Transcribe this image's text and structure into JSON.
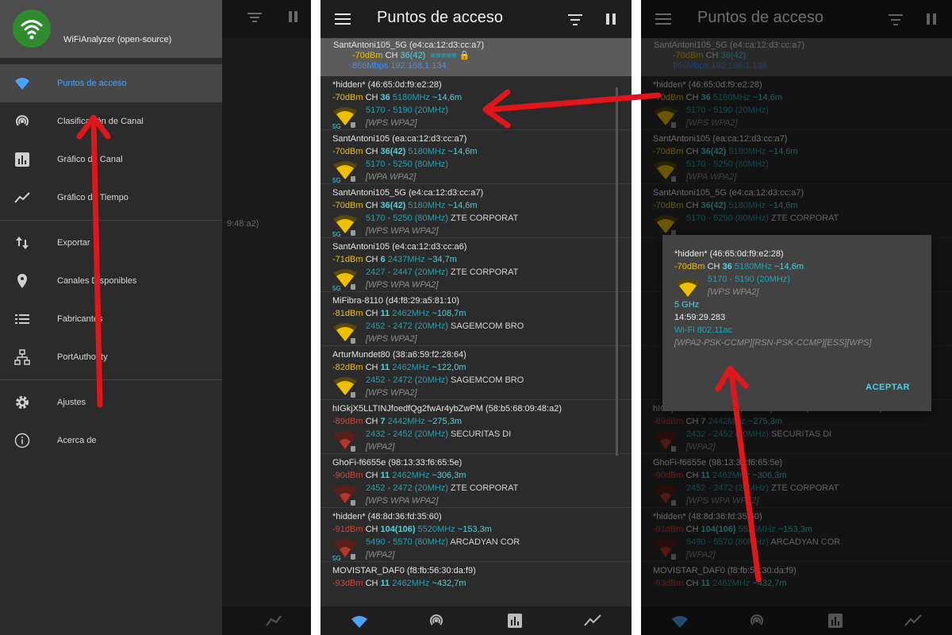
{
  "app": {
    "title": "Puntos de acceso",
    "drawer_app_name": "WiFiAnalyzer (open-source)"
  },
  "colors": {
    "accent": "#4fd3e0",
    "signal_good": "#f0c000",
    "signal_bad": "#d9412f",
    "arrow": "#e0161b",
    "drawer_active": "#4aa3ff"
  },
  "drawer": {
    "items": [
      {
        "label": "Puntos de acceso",
        "icon": "wifi-icon"
      },
      {
        "label": "Clasificación de Canal",
        "icon": "antenna-icon"
      },
      {
        "label": "Gráfico de Canal",
        "icon": "bar-chart-icon"
      },
      {
        "label": "Gráfico de Tiempo",
        "icon": "line-chart-icon"
      },
      {
        "label": "Exportar",
        "icon": "swap-vert-icon"
      },
      {
        "label": "Canales Disponibles",
        "icon": "location-pin-icon"
      },
      {
        "label": "Fabricantes",
        "icon": "list-icon"
      },
      {
        "label": "PortAuthority",
        "icon": "network-icon"
      },
      {
        "label": "Ajustes",
        "icon": "settings-icon"
      },
      {
        "label": "Acerca de",
        "icon": "info-icon"
      }
    ],
    "background_mac_fragment": "9:48:a2)"
  },
  "connected": {
    "ssid": "SantAntoni105_5G (e4:ca:12:d3:cc:a7)",
    "level": "-70dBm",
    "ch_label": "CH",
    "channel": "36(42)",
    "speed_ip": "866Mbps 192.168.1.134"
  },
  "access_points": [
    {
      "ssid": "*hidden* (46:65:0d:f9:e2:28)",
      "level": "-70dBm",
      "red": false,
      "channel": "36",
      "freq": "5180MHz",
      "dist": "~14,6m",
      "range": "5170 - 5190 (20MHz)",
      "vendor": "",
      "cap": "[WPS WPA2]",
      "band": "5G"
    },
    {
      "ssid": "SantAntoni105 (ea:ca:12:d3:cc:a7)",
      "level": "-70dBm",
      "red": false,
      "channel": "36(42)",
      "freq": "5180MHz",
      "dist": "~14,6m",
      "range": "5170 - 5250 (80MHz)",
      "vendor": "",
      "cap": "[WPA WPA2]",
      "band": "5G"
    },
    {
      "ssid": "SantAntoni105_5G (e4:ca:12:d3:cc:a7)",
      "level": "-70dBm",
      "red": false,
      "channel": "36(42)",
      "freq": "5180MHz",
      "dist": "~14,6m",
      "range": "5170 - 5250 (80MHz)",
      "vendor": "ZTE CORPORAT",
      "cap": "[WPS WPA WPA2]",
      "band": "5G"
    },
    {
      "ssid": "SantAntoni105 (e4:ca:12:d3:cc:a6)",
      "level": "-71dBm",
      "red": false,
      "channel": "6",
      "freq": "2437MHz",
      "dist": "~34,7m",
      "range": "2427 - 2447 (20MHz)",
      "vendor": "ZTE CORPORAT",
      "cap": "[WPS WPA WPA2]",
      "band": "5G"
    },
    {
      "ssid": "MiFibra-8110 (d4:f8:29:a5:81:10)",
      "level": "-81dBm",
      "red": false,
      "channel": "11",
      "freq": "2462MHz",
      "dist": "~108,7m",
      "range": "2452 - 2472 (20MHz)",
      "vendor": "SAGEMCOM BRO",
      "cap": "[WPS WPA2]",
      "band": ""
    },
    {
      "ssid": "ArturMundet80 (38:a6:59:f2:28:64)",
      "level": "-82dBm",
      "red": false,
      "channel": "11",
      "freq": "2462MHz",
      "dist": "~122,0m",
      "range": "2452 - 2472 (20MHz)",
      "vendor": "SAGEMCOM BRO",
      "cap": "[WPS WPA2]",
      "band": ""
    },
    {
      "ssid": "hIGkjX5LLTINJfoedfQg2fwAr4ybZwPM (58:b5:68:09:48:a2)",
      "level": "-89dBm",
      "red": true,
      "channel": "7",
      "freq": "2442MHz",
      "dist": "~275,3m",
      "range": "2432 - 2452 (20MHz)",
      "vendor": "SECURITAS DI",
      "cap": "[WPA2]",
      "band": ""
    },
    {
      "ssid": "GhoFi-f6655e (98:13:33:f6:65:5e)",
      "level": "-90dBm",
      "red": true,
      "channel": "11",
      "freq": "2462MHz",
      "dist": "~306,3m",
      "range": "2452 - 2472 (20MHz)",
      "vendor": "ZTE CORPORAT",
      "cap": "[WPS WPA WPA2]",
      "band": ""
    },
    {
      "ssid": "*hidden* (48:8d:36:fd:35:60)",
      "level": "-91dBm",
      "red": true,
      "channel": "104(106)",
      "freq": "5520MHz",
      "dist": "~153,3m",
      "range": "5490 - 5570 (80MHz)",
      "vendor": "ARCADYAN COR",
      "cap": "[WPA2]",
      "band": "5G"
    },
    {
      "ssid": "MOVISTAR_DAF0 (f8:fb:56:30:da:f9)",
      "level": "-93dBm",
      "red": true,
      "channel": "11",
      "freq": "2462MHz",
      "dist": "~432,7m",
      "range": "",
      "vendor": "",
      "cap": "",
      "band": ""
    }
  ],
  "screen3_list": [
    {
      "ssid": "*hidden* (46:65:0d:f9:e2:28)",
      "level": "-70dBm",
      "red": false,
      "channel": "36",
      "freq": "5180MHz",
      "dist": "~14,6m",
      "range": "5170 - 5190 (20MHz)",
      "vendor": "",
      "cap": "[WPS WPA2]",
      "band": ""
    },
    {
      "ssid": "SantAntoni105 (ea:ca:12:d3:cc:a7)",
      "level": "-70dBm",
      "red": false,
      "channel": "36(42)",
      "freq": "5180MHz",
      "dist": "~14,6m",
      "range": "5170 - 5250 (80MHz)",
      "vendor": "",
      "cap": "[WPA WPA2]",
      "band": ""
    },
    {
      "ssid": "SantAntoni105_5G (e4:ca:12:d3:cc:a7)",
      "level": "-70dBm",
      "red": false,
      "channel": "36(42)",
      "freq": "5180MHz",
      "dist": "~14,6m",
      "range": "5170 - 5250 (80MHz)",
      "vendor": "ZTE CORPORAT",
      "cap": "",
      "band": ""
    },
    {
      "ssid": "",
      "level": "",
      "red": false,
      "channel": "",
      "freq": "",
      "dist": "",
      "range": "",
      "vendor": "",
      "cap": "",
      "band": ""
    },
    {
      "ssid": "",
      "level": "",
      "red": false,
      "channel": "",
      "freq": "",
      "dist": "",
      "range": "",
      "vendor": "",
      "cap": "",
      "band": ""
    },
    {
      "ssid": "",
      "level": "",
      "red": false,
      "channel": "",
      "freq": "",
      "dist": "",
      "range": "",
      "vendor": "",
      "cap": "",
      "band": ""
    },
    {
      "ssid": "hIGkjX5LLTINJfoedfQg2fwAr4ybZwPM (58:b5:68:09:48:a2)",
      "level": "-89dBm",
      "red": true,
      "channel": "7",
      "freq": "2442MHz",
      "dist": "~275,3m",
      "range": "2432 - 2452 (20MHz)",
      "vendor": "SECURITAS DI",
      "cap": "[WPA2]",
      "band": ""
    },
    {
      "ssid": "GhoFi-f6655e (98:13:33:f6:65:5e)",
      "level": "-90dBm",
      "red": true,
      "channel": "11",
      "freq": "2462MHz",
      "dist": "~306,3m",
      "range": "2452 - 2472 (20MHz)",
      "vendor": "ZTE CORPORAT",
      "cap": "[WPS WPA WPA2]",
      "band": ""
    },
    {
      "ssid": "*hidden* (48:8d:36:fd:35:60)",
      "level": "-91dBm",
      "red": true,
      "channel": "104(106)",
      "freq": "5520MHz",
      "dist": "~153,3m",
      "range": "5490 - 5570 (80MHz)",
      "vendor": "ARCADYAN COR",
      "cap": "[WPA2]",
      "band": ""
    },
    {
      "ssid": "MOVISTAR_DAF0 (f8:fb:56:30:da:f9)",
      "level": "-93dBm",
      "red": true,
      "channel": "11",
      "freq": "2462MHz",
      "dist": "~432,7m",
      "range": "",
      "vendor": "",
      "cap": "",
      "band": ""
    }
  ],
  "dialog": {
    "ssid": "*hidden* (46:65:0d:f9:e2:28)",
    "level": "-70dBm",
    "ch_label": "CH",
    "channel": "36",
    "freq": "5180MHz",
    "dist": "~14,6m",
    "range": "5170 - 5190 (20MHz)",
    "cap": "[WPS WPA2]",
    "band": "5 GHz",
    "time": "14:59:29.283",
    "standard": "Wi-Fi 802.11ac",
    "capabilities": "[WPA2-PSK-CCMP][RSN-PSK-CCMP][ESS][WPS]",
    "ok_label": "ACEPTAR"
  },
  "bottom_nav": [
    "wifi-icon",
    "antenna-icon",
    "bar-chart-icon",
    "line-chart-icon"
  ]
}
